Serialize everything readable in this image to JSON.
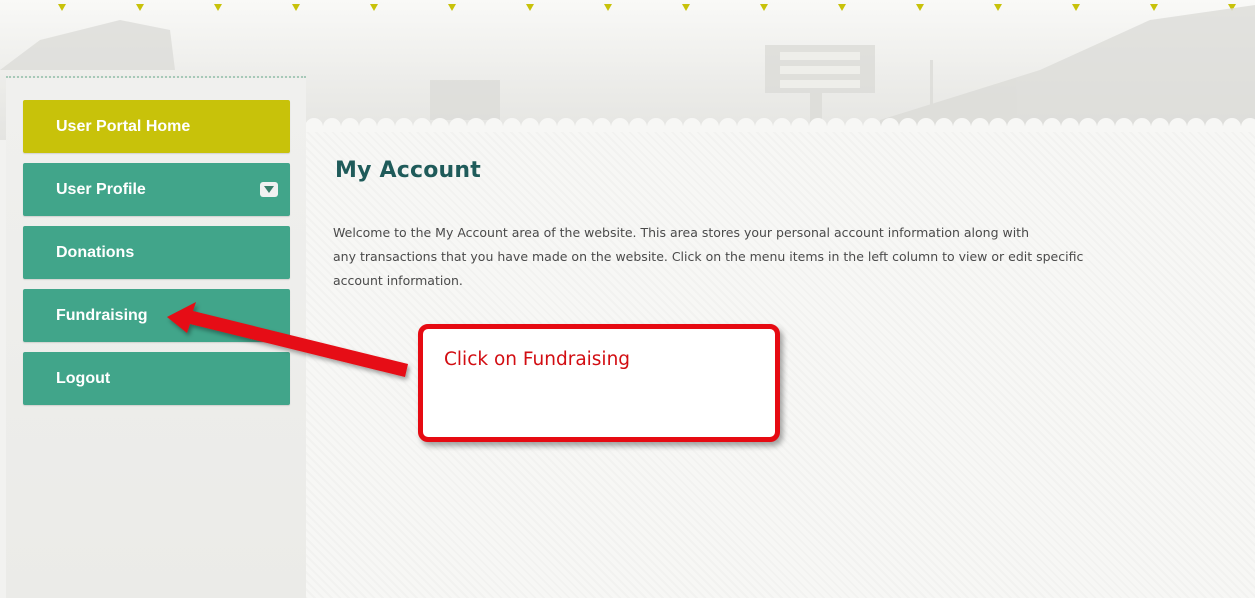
{
  "nav": {
    "items": [
      {
        "label": "User Portal Home",
        "active": true
      },
      {
        "label": "User Profile",
        "has_dropdown": true
      },
      {
        "label": "Donations"
      },
      {
        "label": "Fundraising"
      },
      {
        "label": "Logout"
      }
    ]
  },
  "main": {
    "title": "My Account",
    "intro_lines": [
      "Welcome to the My Account area of the website.  This area stores your personal account information along with",
      "any transactions that you have made on the website.  Click on the menu items in the left column to view or edit  specific",
      "account information."
    ]
  },
  "annotation": {
    "text": "Click on Fundraising"
  },
  "colors": {
    "accent_yellow": "#c8c20a",
    "nav_green": "#41a58a",
    "title_teal": "#1f5b5a",
    "callout_red": "#e60a12"
  }
}
